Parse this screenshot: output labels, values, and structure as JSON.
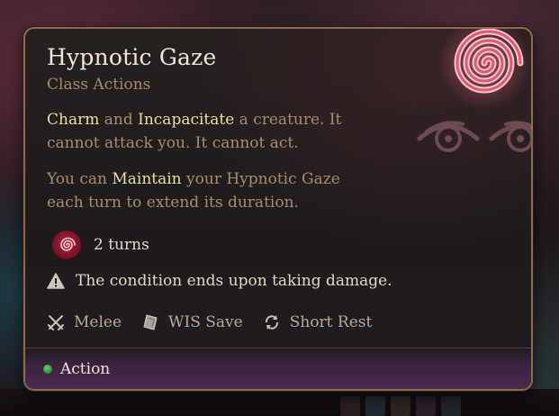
{
  "spell": {
    "title": "Hypnotic Gaze",
    "category": "Class Actions",
    "description1": {
      "kw1": "Charm",
      "t1": " and ",
      "kw2": "Incapacitate",
      "t2": " a creature. It cannot attack you. It cannot act."
    },
    "description2": {
      "t1": "You can ",
      "kw1": "Maintain",
      "t2": " your Hypnotic Gaze each turn to extend its duration."
    },
    "duration": "2 turns",
    "duration_icon": "hypnotic-spiral-icon",
    "warning": "The condition ends upon taking damage.",
    "warning_icon": "warning-triangle-icon",
    "properties": [
      {
        "label": "Melee",
        "icon": "crossed-swords-icon"
      },
      {
        "label": "WIS Save",
        "icon": "save-shield-icon"
      },
      {
        "label": "Short Rest",
        "icon": "recharge-arrows-icon"
      }
    ],
    "cost": {
      "label": "Action",
      "icon": "action-dot-icon"
    },
    "art_icon": "hypnotic-gaze-art-icon"
  },
  "colors": {
    "highlight": "#e9dfa8",
    "body_text": "#a88c6e",
    "border": "#8d6b4f",
    "action_green": "#3da843",
    "spiral_red": "#e15a72"
  }
}
